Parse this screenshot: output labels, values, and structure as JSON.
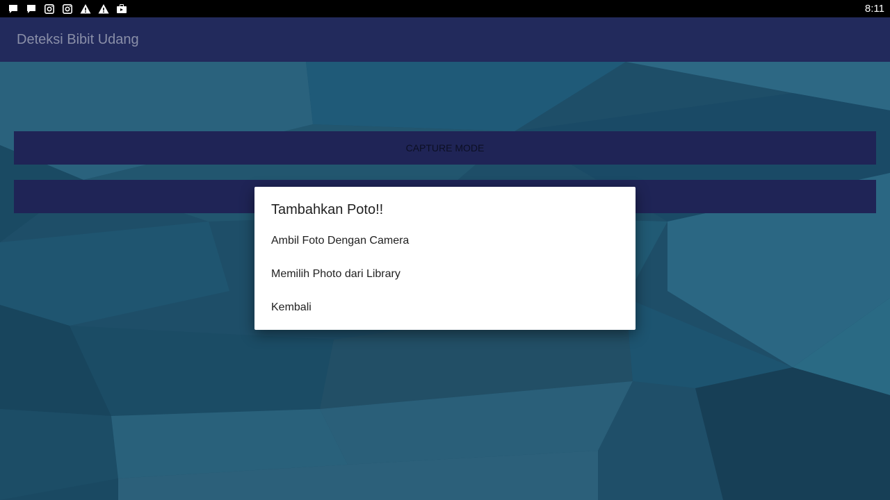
{
  "status_bar": {
    "time": "8:11",
    "icons": [
      "chat-icon",
      "chat-icon",
      "instagram-icon",
      "instagram-icon",
      "warning-icon",
      "warning-icon",
      "briefcase-icon"
    ]
  },
  "app_bar": {
    "title": "Deteksi Bibit Udang"
  },
  "main": {
    "capture_button_label": "CAPTURE MODE",
    "second_button_label": ""
  },
  "dialog": {
    "title": "Tambahkan Poto!!",
    "items": [
      {
        "label": "Ambil Foto Dengan Camera"
      },
      {
        "label": "Memilih Photo dari Library"
      },
      {
        "label": "Kembali"
      }
    ]
  },
  "colors": {
    "app_bar": "#222a5c",
    "button": "#1f2456",
    "background": "#1c4a63"
  }
}
